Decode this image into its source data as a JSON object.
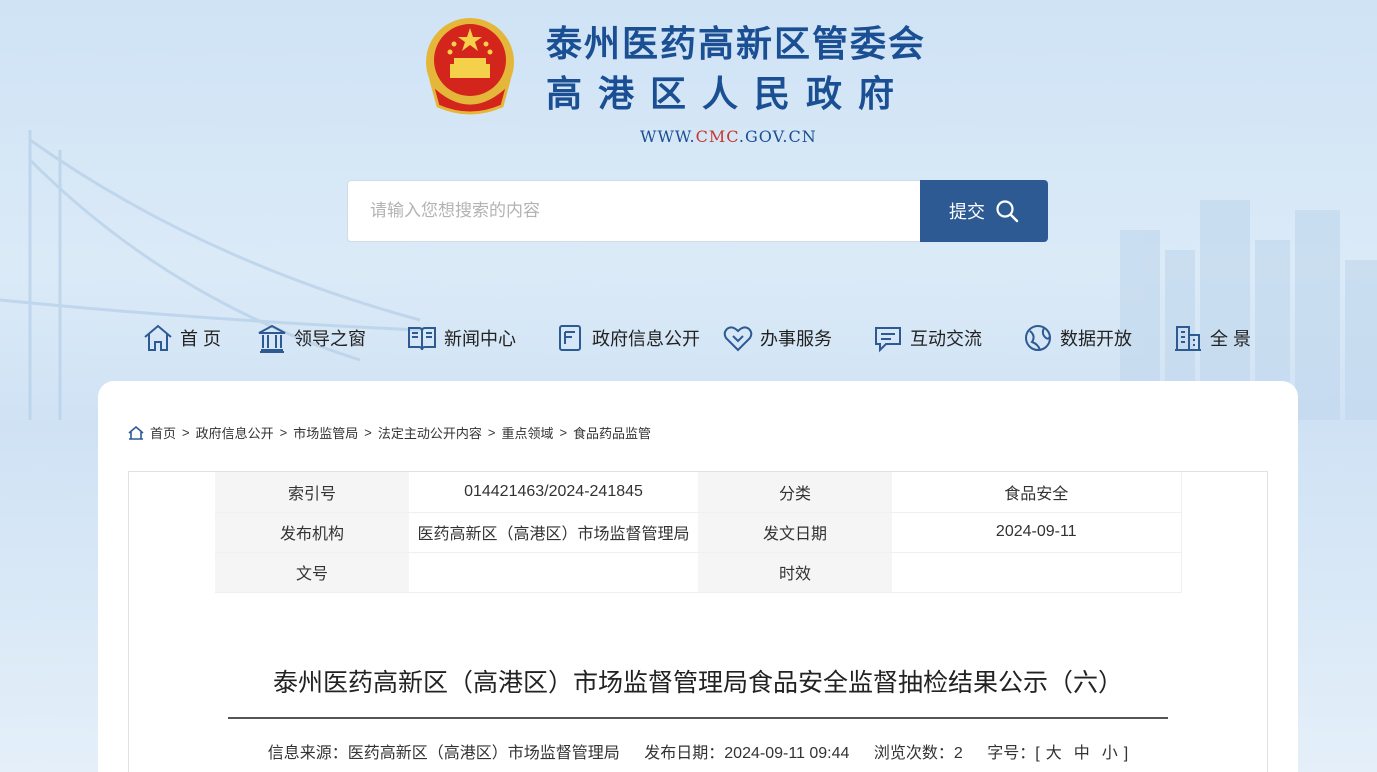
{
  "header": {
    "org_line1": "泰州医药高新区管委会",
    "org_line2": "高港区人民政府",
    "url_prefix": "WWW.",
    "url_highlight": "CMC",
    "url_suffix": ".GOV.CN"
  },
  "search": {
    "placeholder": "请输入您想搜索的内容",
    "submit_label": "提交"
  },
  "nav": [
    {
      "label": "首 页",
      "icon": "home-icon"
    },
    {
      "label": "领导之窗",
      "icon": "building-icon"
    },
    {
      "label": "新闻中心",
      "icon": "book-icon"
    },
    {
      "label": "政府信息公开",
      "icon": "document-icon"
    },
    {
      "label": "办事服务",
      "icon": "handshake-icon"
    },
    {
      "label": "互动交流",
      "icon": "chat-icon"
    },
    {
      "label": "数据开放",
      "icon": "globe-icon"
    },
    {
      "label": "全 景",
      "icon": "city-icon"
    }
  ],
  "breadcrumb": [
    "首页",
    "政府信息公开",
    "市场监管局",
    "法定主动公开内容",
    "重点领域",
    "食品药品监管"
  ],
  "meta": {
    "index_label": "索引号",
    "index_value": "014421463/2024-241845",
    "category_label": "分类",
    "category_value": "食品安全",
    "publisher_label": "发布机构",
    "publisher_value": "医药高新区（高港区）市场监督管理局",
    "date_label": "发文日期",
    "date_value": "2024-09-11",
    "docno_label": "文号",
    "docno_value": "",
    "validity_label": "时效",
    "validity_value": ""
  },
  "article": {
    "title": "泰州医药高新区（高港区）市场监督管理局食品安全监督抽检结果公示（六）",
    "source": "信息来源：医药高新区（高港区）市场监督管理局",
    "published": "发布日期：2024-09-11 09:44",
    "views": "浏览次数：2",
    "font_size_label": "字号：[",
    "font_large": "大",
    "font_medium": "中",
    "font_small": "小",
    "font_size_close": "]"
  },
  "colors": {
    "brand_blue": "#1b4f93",
    "button_blue": "#2e5a94",
    "url_red": "#c8372d"
  }
}
